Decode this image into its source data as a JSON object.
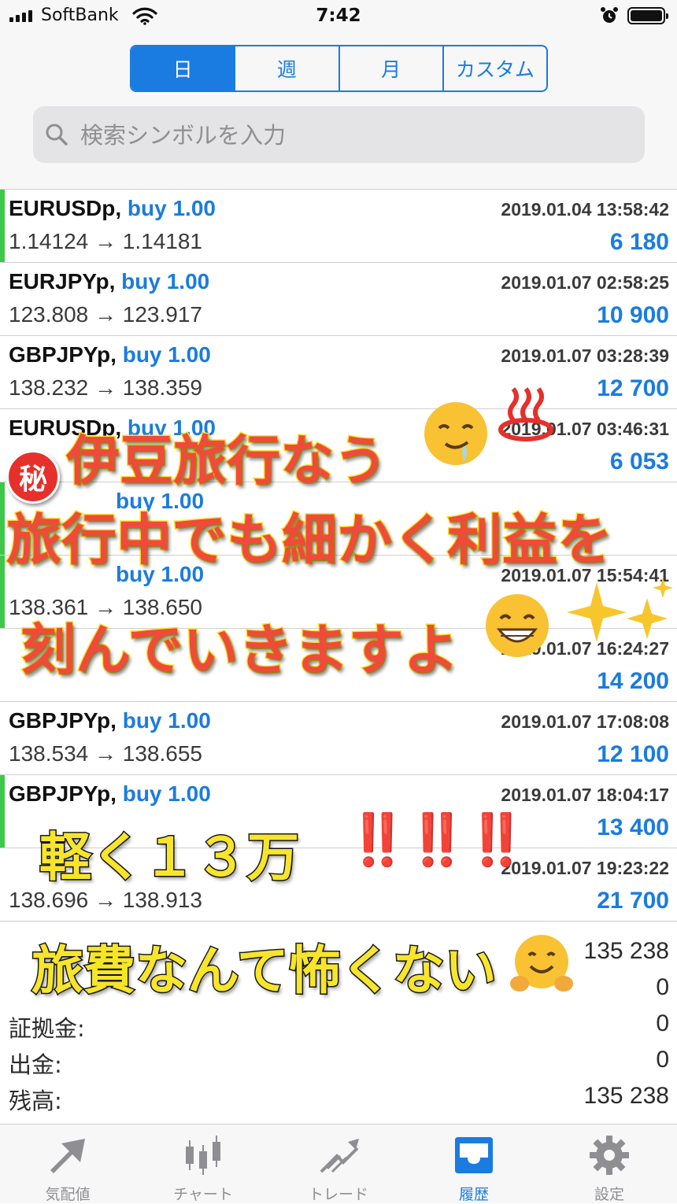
{
  "status_bar": {
    "carrier": "SoftBank",
    "time": "7:42"
  },
  "period_tabs": [
    {
      "label": "日",
      "active": true
    },
    {
      "label": "週",
      "active": false
    },
    {
      "label": "月",
      "active": false
    },
    {
      "label": "カスタム",
      "active": false
    }
  ],
  "search": {
    "placeholder": "検索シンボルを入力"
  },
  "trades": [
    {
      "symbol": "EURUSDp,",
      "type": "buy 1.00",
      "time": "2019.01.04 13:58:42",
      "prices": "1.14124 → 1.14181",
      "profit": "6 180"
    },
    {
      "symbol": "EURJPYp,",
      "type": "buy 1.00",
      "time": "2019.01.07 02:58:25",
      "prices": "123.808 → 123.917",
      "profit": "10 900"
    },
    {
      "symbol": "GBPJPYp,",
      "type": "buy 1.00",
      "time": "2019.01.07 03:28:39",
      "prices": "138.232 → 138.359",
      "profit": "12 700"
    },
    {
      "symbol": "EURUSDp,",
      "type": "buy 1.00",
      "time": "2019.01.07 03:46:31",
      "prices": "",
      "profit": "6 053"
    },
    {
      "symbol": "",
      "type": "buy 1.00",
      "time": "",
      "prices": "",
      "profit": ""
    },
    {
      "symbol": "",
      "type": "buy 1.00",
      "time": "2019.01.07 15:54:41",
      "prices": "138.361 → 138.650",
      "profit": ""
    },
    {
      "symbol": "",
      "type": "",
      "time": "2019.01.07 16:24:27",
      "prices": "",
      "profit": "14 200"
    },
    {
      "symbol": "GBPJPYp,",
      "type": "buy 1.00",
      "time": "2019.01.07 17:08:08",
      "prices": "138.534 → 138.655",
      "profit": "12 100"
    },
    {
      "symbol": "GBPJPYp,",
      "type": "buy 1.00",
      "time": "2019.01.07 18:04:17",
      "prices": "",
      "profit": "13 400"
    },
    {
      "symbol": "",
      "type": "",
      "time": "2019.01.07 19:23:22",
      "prices": "138.696 → 138.913",
      "profit": "21 700"
    }
  ],
  "summary": [
    {
      "label": "",
      "value": "135 238"
    },
    {
      "label": "",
      "value": "0"
    },
    {
      "label": "証拠金:",
      "value": "0"
    },
    {
      "label": "出金:",
      "value": "0"
    },
    {
      "label": "残高:",
      "value": "135 238"
    }
  ],
  "overlay": {
    "line1": "伊豆旅行なう",
    "line2": "旅行中でも細かく利益を",
    "line3": "刻んでいきますよ",
    "line4": "軽く１３万",
    "line4_marks": "‼️‼️‼️",
    "line5": "旅費なんて怖くない",
    "badge": "秘"
  },
  "nav_tabs": [
    {
      "label": "気配値",
      "icon": "quotes-icon",
      "active": false
    },
    {
      "label": "チャート",
      "icon": "chart-icon",
      "active": false
    },
    {
      "label": "トレード",
      "icon": "trade-icon",
      "active": false
    },
    {
      "label": "履歴",
      "icon": "history-icon",
      "active": true
    },
    {
      "label": "設定",
      "icon": "settings-icon",
      "active": false
    }
  ],
  "colors": {
    "accent": "#1a7ce0",
    "buy_bar": "#3ec84a",
    "caption_red": "#f04a3a",
    "caption_yellow": "#f7e52c"
  }
}
